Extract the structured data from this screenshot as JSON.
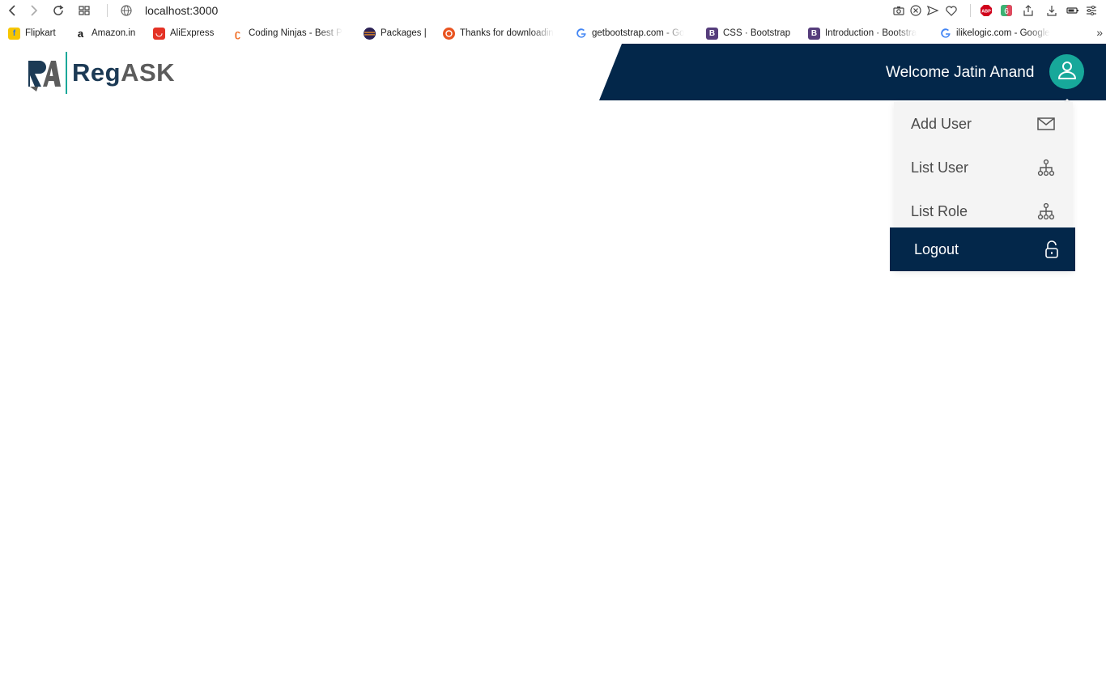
{
  "browser": {
    "url": "localhost:3000",
    "bookmarks": [
      {
        "label": "Flipkart",
        "icon": "flipkart-icon",
        "color": "#f7c600"
      },
      {
        "label": "Amazon.in",
        "icon": "amazon-icon",
        "color": "#ffffff"
      },
      {
        "label": "AliExpress",
        "icon": "aliexpress-icon",
        "color": "#e43225"
      },
      {
        "label": "Coding Ninjas - Best P",
        "icon": "coding-ninjas-icon",
        "color": "#ffffff"
      },
      {
        "label": "Packages |",
        "icon": "packages-icon",
        "color": "#ffffff"
      },
      {
        "label": "Thanks for downloadin",
        "icon": "ubuntu-icon",
        "color": "#e95420"
      },
      {
        "label": "getbootstrap.com - Go",
        "icon": "google-icon",
        "color": "#ffffff"
      },
      {
        "label": "CSS · Bootstrap",
        "icon": "bootstrap-icon",
        "color": "#563d7c"
      },
      {
        "label": "Introduction · Bootstra",
        "icon": "bootstrap-icon",
        "color": "#563d7c"
      },
      {
        "label": "ilikelogic.com - Google",
        "icon": "google-icon",
        "color": "#ffffff"
      }
    ],
    "more_label": "»"
  },
  "header": {
    "logo_mark": "RA",
    "logo_reg": "Reg",
    "logo_ask": "ASK",
    "welcome": "Welcome Jatin Anand"
  },
  "menu": {
    "items": [
      {
        "label": "Add User",
        "icon": "mail-icon"
      },
      {
        "label": "List User",
        "icon": "hierarchy-icon"
      },
      {
        "label": "List Role",
        "icon": "hierarchy-icon"
      }
    ],
    "logout": {
      "label": "Logout",
      "icon": "unlock-icon"
    }
  },
  "colors": {
    "navy": "#03274a",
    "teal": "#17a89a",
    "menu_bg": "#f4f4f4"
  }
}
